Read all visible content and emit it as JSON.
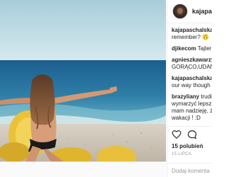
{
  "header": {
    "username": "kajapaschalska"
  },
  "comments": [
    {
      "user": "kajapaschalska",
      "text": "remember? 🙃"
    },
    {
      "user": "djikecom",
      "text": "Tajter"
    },
    {
      "user": "agnieszkawarzy",
      "text": "GORĄCO,UDAN"
    },
    {
      "user": "kajapaschalska",
      "text": "our way though"
    },
    {
      "user": "brazyliany",
      "text": "trudi",
      "lines": [
        "wymarzyć lepsz",
        "mam nadzieję, ż",
        "wakacji ! :D"
      ]
    }
  ],
  "likes": "15 polubień",
  "date": "15 LIPCA",
  "add_comment_placeholder": "Dodaj komenta",
  "icons": {
    "avatar": "profile-avatar",
    "heart": "heart-icon",
    "comment": "comment-icon"
  },
  "colors": {
    "text": "#262626",
    "muted": "#999999",
    "border": "#efefef"
  }
}
